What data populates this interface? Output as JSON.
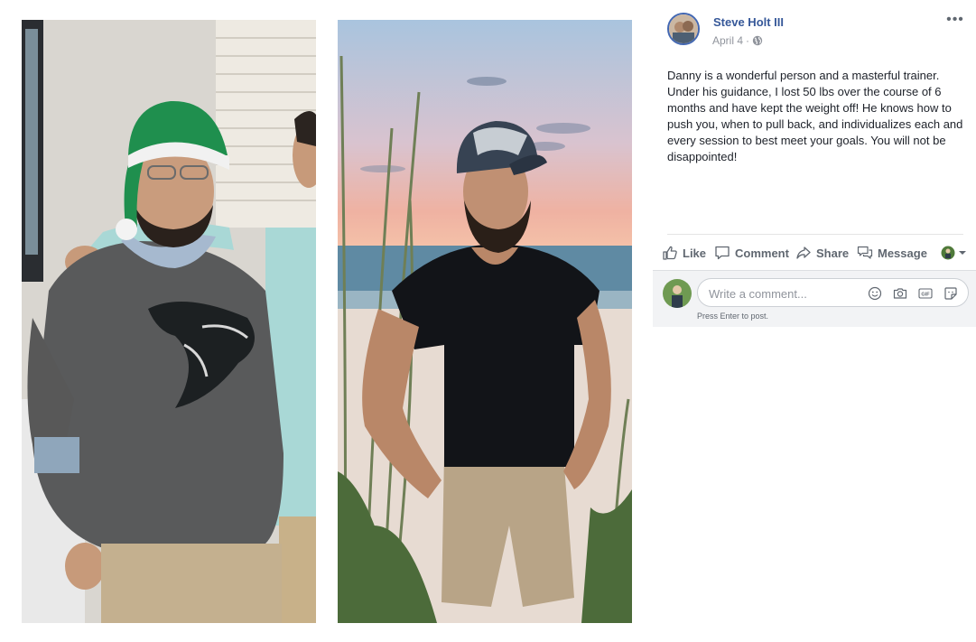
{
  "post": {
    "author": "Steve Holt III",
    "date": "April 4",
    "separator": "·",
    "privacy_icon": "globe-icon",
    "more_icon": "more-dots-icon",
    "more_label": "•••",
    "text": "Danny is a wonderful person and a masterful trainer. Under his guidance, I lost 50 lbs over the course of 6 months and have kept the weight off! He knows how to push you, when to pull back, and individualizes each and every session to best meet your goals. You will not be disappointed!"
  },
  "photos": [
    {
      "name": "before-photo"
    },
    {
      "name": "after-photo"
    }
  ],
  "actions": {
    "like": "Like",
    "comment": "Comment",
    "share": "Share",
    "message": "Message"
  },
  "comment_box": {
    "placeholder": "Write a comment...",
    "hint": "Press Enter to post.",
    "icons": [
      "emoji-icon",
      "camera-icon",
      "gif-icon",
      "sticker-icon"
    ]
  },
  "colors": {
    "link": "#365899",
    "action_text": "#606770",
    "muted": "#90949c",
    "comment_bg": "#f2f3f5"
  }
}
